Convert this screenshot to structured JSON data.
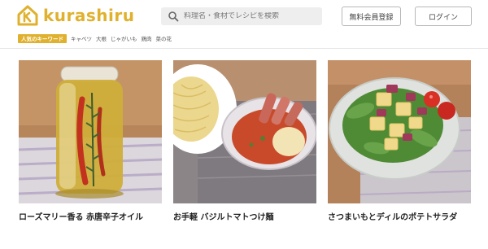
{
  "header": {
    "logo_text": "kurashiru",
    "search": {
      "placeholder": "料理名・食材でレシピを検索"
    },
    "member_button": "無料会員登録",
    "login_button": "ログイン"
  },
  "keywords": {
    "badge": "人気のキーワード",
    "items": [
      "キャベツ",
      "大根",
      "じゃがいも",
      "鶏肉",
      "菜の花"
    ]
  },
  "recipes": [
    {
      "title": "ローズマリー香る 赤唐辛子オイル"
    },
    {
      "title": "お手軽 バジルトマトつけ麺"
    },
    {
      "title": "さつまいもとディルのポテトサラダ"
    }
  ],
  "colors": {
    "brand": "#e0b12e"
  }
}
